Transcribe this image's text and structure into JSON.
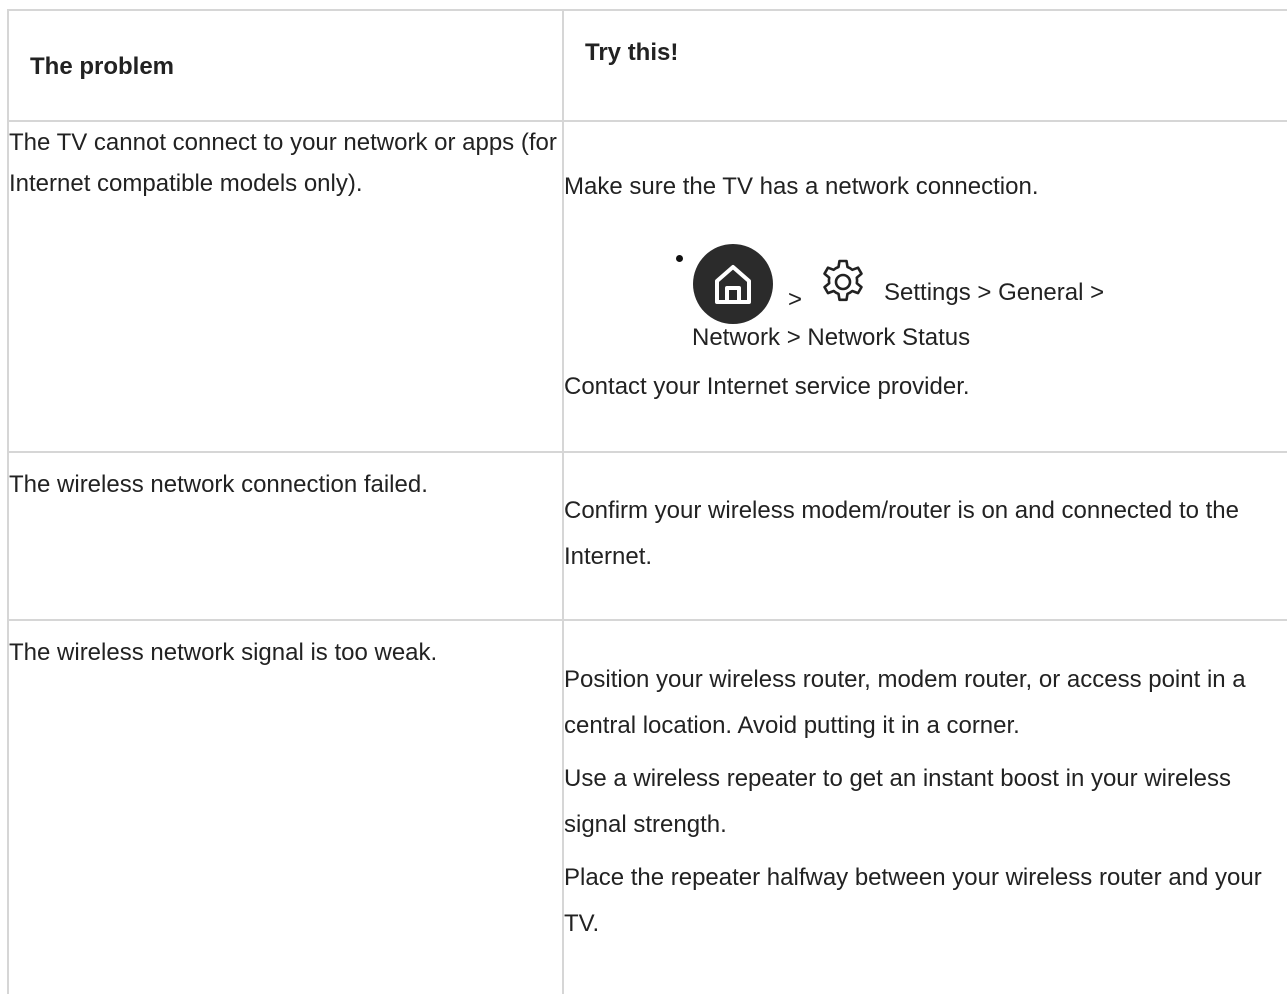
{
  "table": {
    "header": {
      "problem": "The problem",
      "try": "Try this!"
    },
    "rows": [
      {
        "problem": "The TV cannot connect to your network or apps (for Internet compatible models only).",
        "solution": {
          "intro": "Make sure the TV has a network connection.",
          "path": {
            "icons": [
              "home-icon",
              "settings-gear-icon"
            ],
            "separator": ">",
            "line1": "Settings > General >",
            "line2": "Network > Network Status"
          },
          "outro": "Contact your Internet service provider."
        }
      },
      {
        "problem": "The wireless network connection failed.",
        "solution": {
          "p1": "Confirm your wireless modem/router is on and connected to the Internet."
        }
      },
      {
        "problem": "The wireless network signal is too weak.",
        "solution": {
          "p1": "Position your wireless router, modem router, or access point in a central location. Avoid putting it in a corner.",
          "p2": "Use a wireless repeater to get an instant boost in your wireless signal strength.",
          "p3": "Place the repeater halfway between your wireless router and your TV."
        }
      }
    ]
  },
  "colors": {
    "text": "#222222",
    "border": "#d6d6d6",
    "home_icon_bg": "#2b2b2b"
  }
}
